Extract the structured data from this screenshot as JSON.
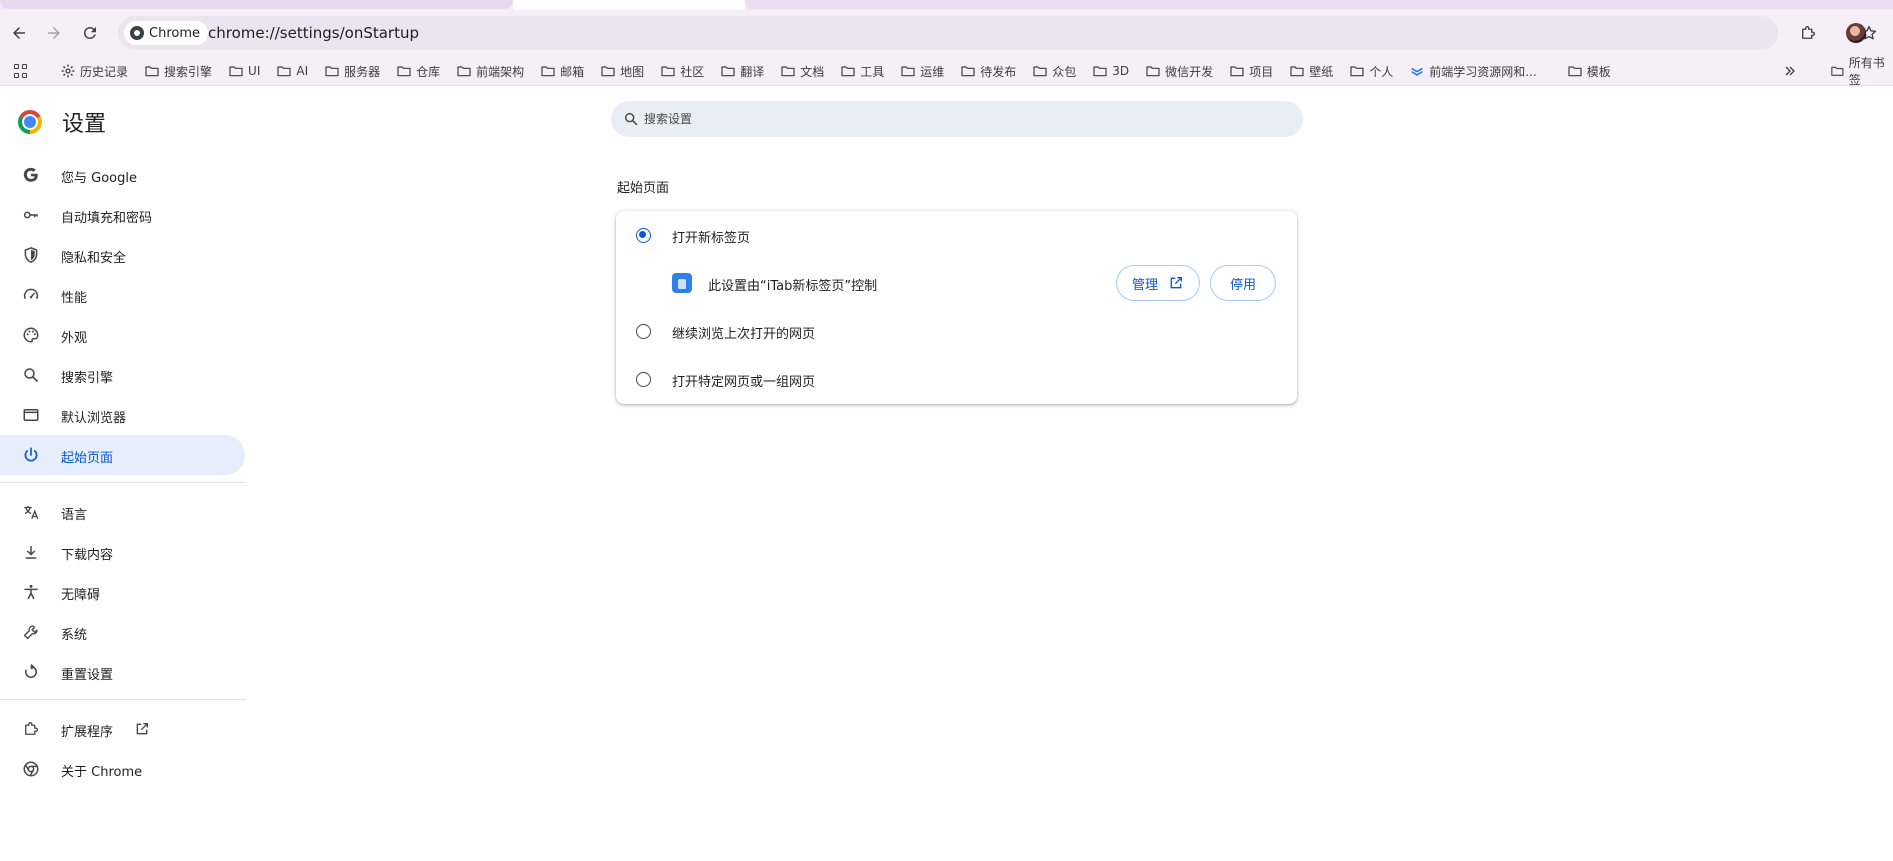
{
  "browser": {
    "site_chip": "Chrome",
    "url": "chrome://settings/onStartup"
  },
  "bookmarks": [
    {
      "label": "历史记录",
      "icon": "gear-icon"
    },
    {
      "label": "搜索引擎",
      "icon": "folder-icon"
    },
    {
      "label": "UI",
      "icon": "folder-icon"
    },
    {
      "label": "AI",
      "icon": "folder-icon"
    },
    {
      "label": "服务器",
      "icon": "folder-icon"
    },
    {
      "label": "仓库",
      "icon": "folder-icon"
    },
    {
      "label": "前端架构",
      "icon": "folder-icon"
    },
    {
      "label": "邮箱",
      "icon": "folder-icon"
    },
    {
      "label": "地图",
      "icon": "folder-icon"
    },
    {
      "label": "社区",
      "icon": "folder-icon"
    },
    {
      "label": "翻译",
      "icon": "folder-icon"
    },
    {
      "label": "文档",
      "icon": "folder-icon"
    },
    {
      "label": "工具",
      "icon": "folder-icon"
    },
    {
      "label": "运维",
      "icon": "folder-icon"
    },
    {
      "label": "待发布",
      "icon": "folder-icon"
    },
    {
      "label": "众包",
      "icon": "folder-icon"
    },
    {
      "label": "3D",
      "icon": "folder-icon"
    },
    {
      "label": "微信开发",
      "icon": "folder-icon"
    },
    {
      "label": "项目",
      "icon": "folder-icon"
    },
    {
      "label": "壁纸",
      "icon": "folder-icon"
    },
    {
      "label": "个人",
      "icon": "folder-icon"
    },
    {
      "label": "前端学习资源网和...",
      "icon": "site-icon"
    },
    {
      "label": "模板",
      "icon": "folder-icon"
    }
  ],
  "bookmarks_all_label": "所有书签",
  "settings": {
    "title": "设置",
    "search_placeholder": "搜索设置"
  },
  "sidebar": {
    "items": [
      {
        "label": "您与 Google",
        "icon": "google-icon"
      },
      {
        "label": "自动填充和密码",
        "icon": "key-icon"
      },
      {
        "label": "隐私和安全",
        "icon": "shield-icon"
      },
      {
        "label": "性能",
        "icon": "speedometer-icon"
      },
      {
        "label": "外观",
        "icon": "palette-icon"
      },
      {
        "label": "搜索引擎",
        "icon": "search-icon"
      },
      {
        "label": "默认浏览器",
        "icon": "browser-window-icon"
      },
      {
        "label": "起始页面",
        "icon": "power-icon"
      },
      {
        "label": "语言",
        "icon": "translate-icon"
      },
      {
        "label": "下载内容",
        "icon": "download-icon"
      },
      {
        "label": "无障碍",
        "icon": "accessibility-icon"
      },
      {
        "label": "系统",
        "icon": "wrench-icon"
      },
      {
        "label": "重置设置",
        "icon": "reset-icon"
      },
      {
        "label": "扩展程序",
        "icon": "puzzle-icon"
      },
      {
        "label": "关于 Chrome",
        "icon": "chrome-icon"
      }
    ],
    "active": "起始页面"
  },
  "startup": {
    "section_title": "起始页面",
    "options": [
      {
        "label": "打开新标签页",
        "checked": true
      },
      {
        "label": "继续浏览上次打开的网页",
        "checked": false
      },
      {
        "label": "打开特定网页或一组网页",
        "checked": false
      }
    ],
    "extension_notice": "此设置由“iTab新标签页”控制",
    "manage_label": "管理",
    "disable_label": "停用"
  },
  "colors": {
    "accent": "#0b57d0",
    "active_bg": "#e6edfb",
    "toolbar_bg": "#f6eff8"
  }
}
